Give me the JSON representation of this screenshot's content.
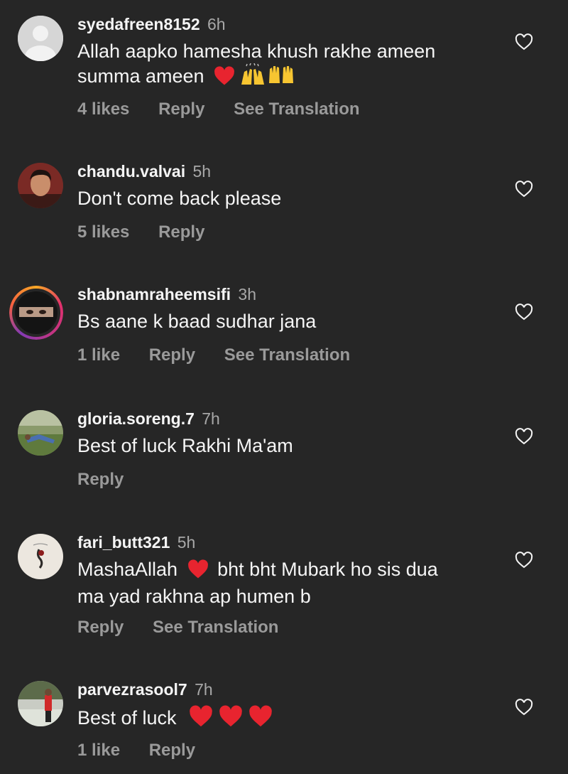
{
  "comments": [
    {
      "username": "syedafreen8152",
      "time": "6h",
      "text_line1": "Allah aapko hamesha khush rakhe ameen",
      "text_line2": "summa ameen",
      "emojis": [
        "red-heart",
        "raising-hands",
        "open-hands"
      ],
      "likes": "4 likes",
      "reply": "Reply",
      "translate": "See Translation"
    },
    {
      "username": "chandu.valvai",
      "time": "5h",
      "text": "Don't come back please",
      "likes": "5 likes",
      "reply": "Reply"
    },
    {
      "username": "shabnamraheemsifi",
      "time": "3h",
      "text": "Bs aane k baad sudhar jana",
      "likes": "1 like",
      "reply": "Reply",
      "translate": "See Translation"
    },
    {
      "username": "gloria.soreng.7",
      "time": "7h",
      "text": "Best of luck Rakhi Ma'am",
      "reply": "Reply"
    },
    {
      "username": "fari_butt321",
      "time": "5h",
      "text_before_emoji": "MashaAllah",
      "text_after_emoji": "bht bht Mubark ho sis dua",
      "text_line2": "ma yad rakhna ap humen b",
      "emojis": [
        "red-heart"
      ],
      "reply": "Reply",
      "translate": "See Translation"
    },
    {
      "username": "parvezrasool7",
      "time": "7h",
      "text": "Best of luck",
      "emojis": [
        "red-heart",
        "red-heart",
        "red-heart"
      ],
      "likes": "1 like",
      "reply": "Reply"
    }
  ],
  "colors": {
    "background": "#262626",
    "primary_text": "#f5f5f5",
    "secondary_text": "#9a9a9a",
    "heart_red": "#e8242f"
  }
}
